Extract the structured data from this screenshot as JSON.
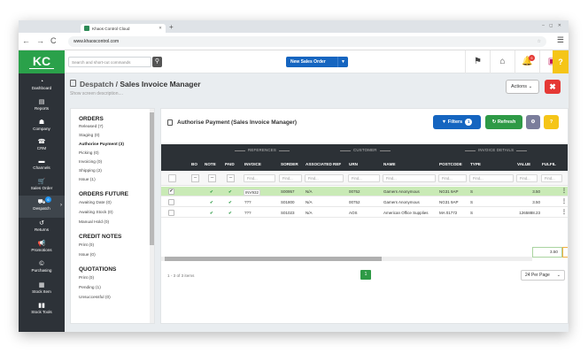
{
  "browser": {
    "tab_title": "Khaos Control Cloud",
    "url": "www.khaoscontrol.com",
    "back": "←",
    "forward": "→",
    "reload": "C",
    "new_tab": "+",
    "window_controls": "– ◻ ✕"
  },
  "header": {
    "logo": "KC",
    "search_placeholder": "Search and short-cut commands",
    "new_sales_order": "New Sales Order",
    "help": "?",
    "notification_count": "5"
  },
  "sidebar": {
    "items": [
      {
        "label": "Dashboard",
        "icon": "dashboard-icon"
      },
      {
        "label": "Reports",
        "icon": "report-icon"
      },
      {
        "label": "Company",
        "icon": "company-icon"
      },
      {
        "label": "CRM",
        "icon": "phone-icon"
      },
      {
        "label": "Channels",
        "icon": "channels-icon"
      },
      {
        "label": "Sales Order",
        "icon": "cart-icon"
      },
      {
        "label": "Despatch",
        "icon": "truck-icon"
      },
      {
        "label": "Returns",
        "icon": "returns-icon"
      },
      {
        "label": "Promotions",
        "icon": "megaphone-icon"
      },
      {
        "label": "Purchasing",
        "icon": "currency-icon"
      },
      {
        "label": "Stock Item",
        "icon": "box-icon"
      },
      {
        "label": "Stock Tools",
        "icon": "chart-icon"
      }
    ],
    "despatch_badge": "6"
  },
  "page": {
    "breadcrumb": "Despatch",
    "separator": " / ",
    "title": "Sales Invoice Manager",
    "description_link": "Show screen description....",
    "actions_label": "Actions",
    "close_label": "✖"
  },
  "left_panel": {
    "orders_heading": "ORDERS",
    "orders": [
      "Released (7)",
      "Staging (0)",
      "Authorise Payment (3)",
      "Picking (0)",
      "Invoicing (0)",
      "Shipping (2)",
      "Issue (1)"
    ],
    "orders_future_heading": "ORDERS FUTURE",
    "orders_future": [
      "Awaiting Date (0)",
      "Awaiting Stock (0)",
      "Manual Hold (0)"
    ],
    "credit_notes_heading": "CREDIT NOTES",
    "credit_notes": [
      "Print (0)",
      "Issue (0)"
    ],
    "quotations_heading": "QUOTATIONS",
    "quotations": [
      "Print (0)",
      "Pending (1)",
      "Unsuccessful (0)"
    ]
  },
  "main": {
    "title": "Authorise Payment (Sales Invoice Manager)",
    "filters_label": "Filters",
    "filters_count": "1",
    "refresh_label": "Refresh",
    "help_label": "?",
    "groups": {
      "references": "REFERENCES",
      "customer": "CUSTOMER",
      "invoice_details": "INVOICE DETAILS"
    },
    "columns": [
      "BO",
      "NOTE",
      "PAID",
      "INVOICE",
      "SORDER",
      "ASSOCIATED REF",
      "URN",
      "NAME",
      "POSTCODE",
      "TYPE",
      "VALUE",
      "FULFIL"
    ],
    "filter_placeholder": "Find...",
    "rows": [
      {
        "checked": "✔",
        "note": "✔",
        "paid": "✔",
        "invoice": "INV932",
        "sorder": "S00957",
        "assoc": "N/A",
        "urn": "00752",
        "name": "Gamers Anonymous",
        "postcode": "NG31 9AP",
        "type": "S",
        "value": "3.50"
      },
      {
        "checked": "",
        "note": "✔",
        "paid": "✔",
        "invoice": "???",
        "sorder": "S01800",
        "assoc": "N/A",
        "urn": "00752",
        "name": "Gamers Anonymous",
        "postcode": "NG31 9AP",
        "type": "S",
        "value": "3.50"
      },
      {
        "checked": "",
        "note": "✔",
        "paid": "✔",
        "invoice": "???",
        "sorder": "S01023",
        "assoc": "N/A",
        "urn": "AOS",
        "name": "American Office Supplies",
        "postcode": "MA 01772",
        "type": "S",
        "value": "1265888.23"
      }
    ],
    "total_value": "3.50",
    "items_count": "1 - 3 of 3 items",
    "current_page": "1",
    "per_page": "24 Per Page"
  }
}
